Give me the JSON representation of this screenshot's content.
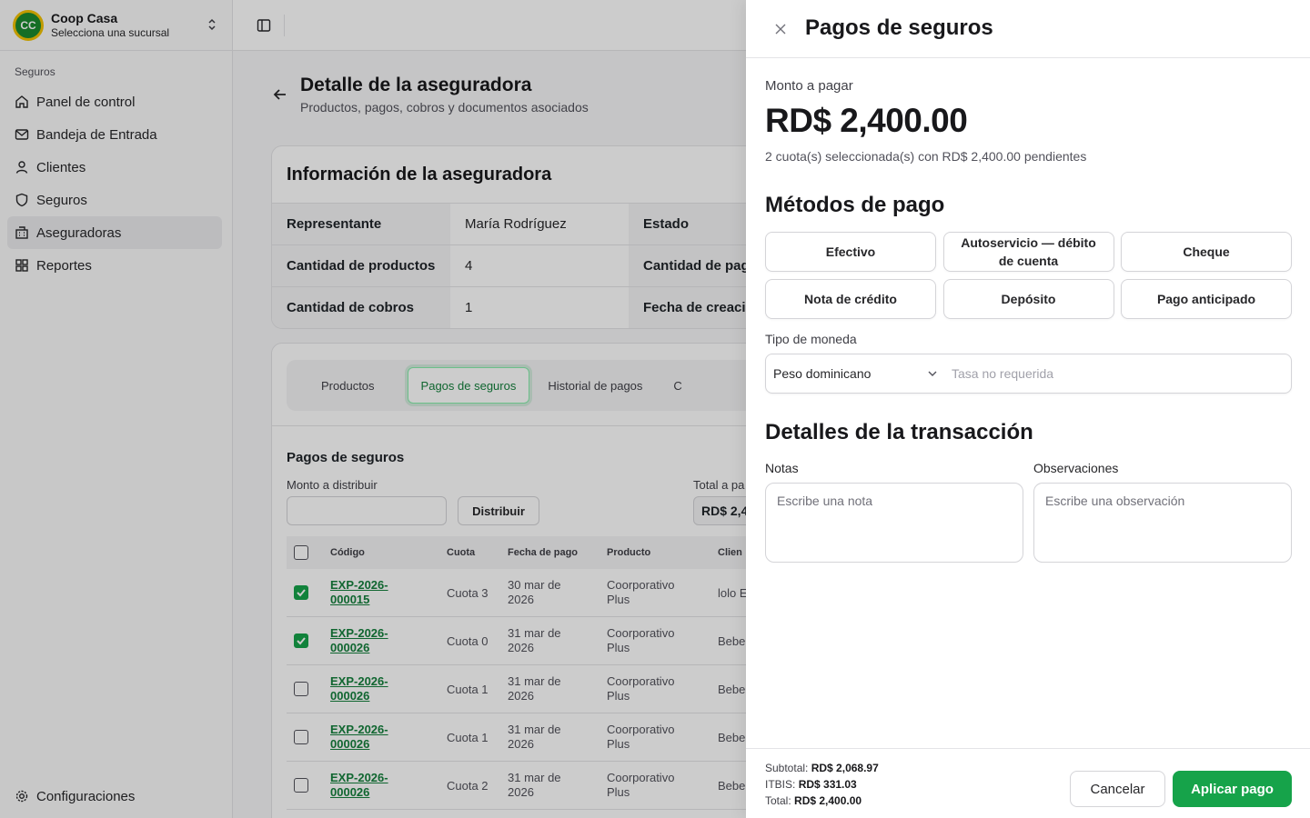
{
  "org": {
    "name": "Coop Casa",
    "subtitle": "Selecciona una sucursal",
    "logo_text": "CC"
  },
  "sidebar": {
    "section": "Seguros",
    "items": [
      {
        "label": "Panel de control",
        "icon": "home-icon"
      },
      {
        "label": "Bandeja de Entrada",
        "icon": "mail-icon"
      },
      {
        "label": "Clientes",
        "icon": "user-icon"
      },
      {
        "label": "Seguros",
        "icon": "shield-icon"
      },
      {
        "label": "Aseguradoras",
        "icon": "building-icon",
        "active": true
      },
      {
        "label": "Reportes",
        "icon": "grid-icon"
      }
    ],
    "settings_label": "Configuraciones"
  },
  "page": {
    "title": "Detalle de la aseguradora",
    "subtitle": "Productos, pagos, cobros y documentos asociados"
  },
  "info": {
    "title": "Información de la aseguradora",
    "rows": [
      {
        "k": "Representante",
        "v": "María Rodríguez",
        "k2": "Estado"
      },
      {
        "k": "Cantidad de productos",
        "v": "4",
        "k2": "Cantidad de pag"
      },
      {
        "k": "Cantidad de cobros",
        "v": "1",
        "k2": "Fecha de creaci"
      }
    ]
  },
  "tabs": [
    "Productos",
    "Pagos de seguros",
    "Historial de pagos",
    "C"
  ],
  "payments": {
    "title": "Pagos de seguros",
    "monto_label": "Monto a distribuir",
    "distribuir_label": "Distribuir",
    "total_label": "Total a pa",
    "total_value": "RD$ 2,4",
    "headers": [
      "Código",
      "Cuota",
      "Fecha de pago",
      "Producto",
      "Clien"
    ],
    "rows": [
      {
        "checked": true,
        "code1": "EXP-2026-",
        "code2": "000015",
        "cuota": "Cuota 3",
        "fecha1": "30 mar de",
        "fecha2": "2026",
        "prod1": "Coorporativo",
        "prod2": "Plus",
        "cliente": "lolo E"
      },
      {
        "checked": true,
        "code1": "EXP-2026-",
        "code2": "000026",
        "cuota": "Cuota 0",
        "fecha1": "31 mar de",
        "fecha2": "2026",
        "prod1": "Coorporativo",
        "prod2": "Plus",
        "cliente": "Bebe"
      },
      {
        "checked": false,
        "code1": "EXP-2026-",
        "code2": "000026",
        "cuota": "Cuota 1",
        "fecha1": "31 mar de",
        "fecha2": "2026",
        "prod1": "Coorporativo",
        "prod2": "Plus",
        "cliente": "Bebe"
      },
      {
        "checked": false,
        "code1": "EXP-2026-",
        "code2": "000026",
        "cuota": "Cuota 1",
        "fecha1": "31 mar de",
        "fecha2": "2026",
        "prod1": "Coorporativo",
        "prod2": "Plus",
        "cliente": "Bebe"
      },
      {
        "checked": false,
        "code1": "EXP-2026-",
        "code2": "000026",
        "cuota": "Cuota 2",
        "fecha1": "31 mar de",
        "fecha2": "2026",
        "prod1": "Coorporativo",
        "prod2": "Plus",
        "cliente": "Bebe"
      }
    ]
  },
  "drawer": {
    "title": "Pagos de seguros",
    "amount_label": "Monto a pagar",
    "amount": "RD$ 2,400.00",
    "amount_sub": "2 cuota(s) seleccionada(s) con RD$ 2,400.00 pendientes",
    "methods_title": "Métodos de pago",
    "methods": [
      "Efectivo",
      "Autoservicio — débito de cuenta",
      "Cheque",
      "Nota de crédito",
      "Depósito",
      "Pago anticipado"
    ],
    "currency_label": "Tipo de moneda",
    "currency_value": "Peso dominicano",
    "rate_placeholder": "Tasa no requerida",
    "details_title": "Detalles de la transacción",
    "notes_label": "Notas",
    "notes_placeholder": "Escribe una nota",
    "obs_label": "Observaciones",
    "obs_placeholder": "Escribe una observación",
    "subtotal_label": "Subtotal:",
    "subtotal": "RD$ 2,068.97",
    "itbis_label": "ITBIS:",
    "itbis": "RD$ 331.03",
    "total_label": "Total:",
    "total": "RD$ 2,400.00",
    "cancel_label": "Cancelar",
    "apply_label": "Aplicar pago"
  },
  "colors": {
    "accent": "#16a34a",
    "link": "#15803d"
  }
}
